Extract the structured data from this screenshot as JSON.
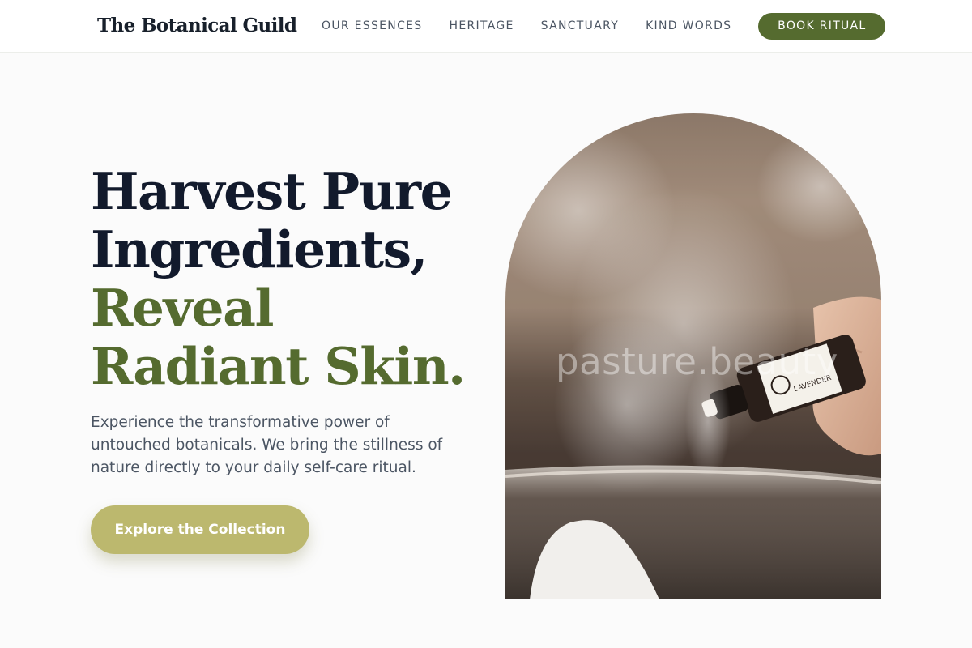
{
  "header": {
    "brand": "The Botanical Guild",
    "nav": [
      {
        "label": "OUR ESSENCES"
      },
      {
        "label": "HERITAGE"
      },
      {
        "label": "SANCTUARY"
      },
      {
        "label": "KIND WORDS"
      }
    ],
    "cta_label": "BOOK RITUAL"
  },
  "hero": {
    "title_line1": "Harvest Pure",
    "title_line2": "Ingredients,",
    "title_line3": "Reveal",
    "title_line4": "Radiant Skin.",
    "description": "Experience the transformative power of untouched botanicals. We bring the stillness of nature directly to your daily self-care ritual.",
    "cta_label": "Explore the Collection",
    "image_watermark": "pasture.beauty",
    "bottle_label": "LAVENDER"
  },
  "colors": {
    "accent": "#556b2f",
    "cta": "#bcb86e",
    "heading": "#121a2c",
    "body_text": "#4b5563"
  },
  "icons": {
    "bottle": "essential-oil-bottle-icon"
  }
}
